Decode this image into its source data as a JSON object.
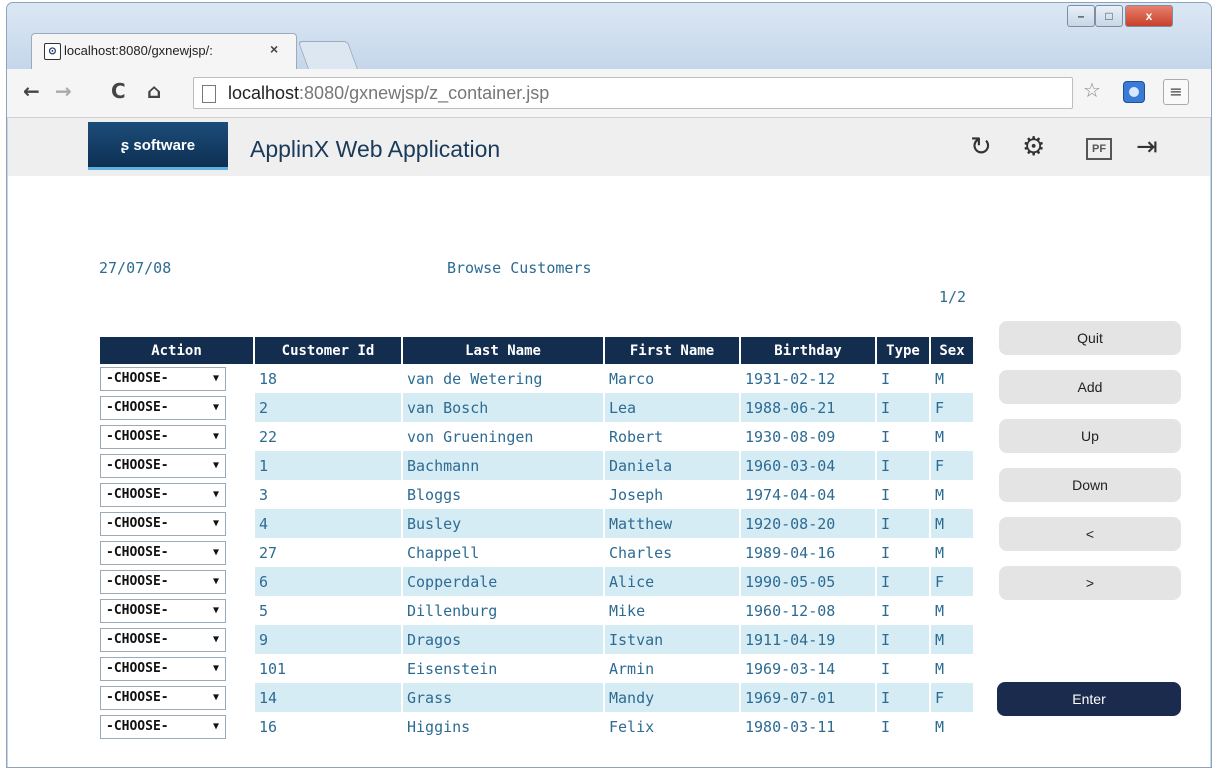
{
  "browser": {
    "tab_title": "localhost:8080/gxnewjsp/:",
    "tab_close": "×",
    "url_host": "localhost",
    "url_rest": ":8080/gxnewjsp/z_container.jsp",
    "back": "←",
    "forward": "→",
    "reload": "C",
    "home": "⌂",
    "star": "☆",
    "menu": "≡",
    "win_min": "–",
    "win_max": "□",
    "win_close": "x"
  },
  "app": {
    "logo_text": "software",
    "title": "ApplinX Web Application",
    "icons": [
      "refresh-icon",
      "settings-icon",
      "pdf-icon",
      "logout-icon"
    ],
    "pdf_label": "PF"
  },
  "screen": {
    "date": "27/07/08",
    "title": "Browse Customers",
    "page_indicator": "1/2"
  },
  "table": {
    "headers": [
      "Action",
      "Customer Id",
      "Last Name",
      "First Name",
      "Birthday",
      "Type",
      "Sex"
    ],
    "select_value": "-CHOOSE-",
    "rows": [
      [
        "18",
        "van de Wetering",
        "Marco",
        "1931-02-12",
        "I",
        "M"
      ],
      [
        "2",
        "van Bosch",
        "Lea",
        "1988-06-21",
        "I",
        "F"
      ],
      [
        "22",
        "von Grueningen",
        "Robert",
        "1930-08-09",
        "I",
        "M"
      ],
      [
        "1",
        "Bachmann",
        "Daniela",
        "1960-03-04",
        "I",
        "F"
      ],
      [
        "3",
        "Bloggs",
        "Joseph",
        "1974-04-04",
        "I",
        "M"
      ],
      [
        "4",
        "Busley",
        "Matthew",
        "1920-08-20",
        "I",
        "M"
      ],
      [
        "27",
        "Chappell",
        "Charles",
        "1989-04-16",
        "I",
        "M"
      ],
      [
        "6",
        "Copperdale",
        "Alice",
        "1990-05-05",
        "I",
        "F"
      ],
      [
        "5",
        "Dillenburg",
        "Mike",
        "1960-12-08",
        "I",
        "M"
      ],
      [
        "9",
        "Dragos",
        "Istvan",
        "1911-04-19",
        "I",
        "M"
      ],
      [
        "101",
        "Eisenstein",
        "Armin",
        "1969-03-14",
        "I",
        "M"
      ],
      [
        "14",
        "Grass",
        "Mandy",
        "1969-07-01",
        "I",
        "F"
      ],
      [
        "16",
        "Higgins",
        "Felix",
        "1980-03-11",
        "I",
        "M"
      ]
    ]
  },
  "buttons": {
    "quit": "Quit",
    "add": "Add",
    "up": "Up",
    "down": "Down",
    "prev": "<",
    "next": ">",
    "enter": "Enter"
  },
  "colors": {
    "header_bg": "#132d4f",
    "row_alt": "#d6ecf5",
    "text": "#2d6b93",
    "enter_bg": "#1a2b4d"
  }
}
